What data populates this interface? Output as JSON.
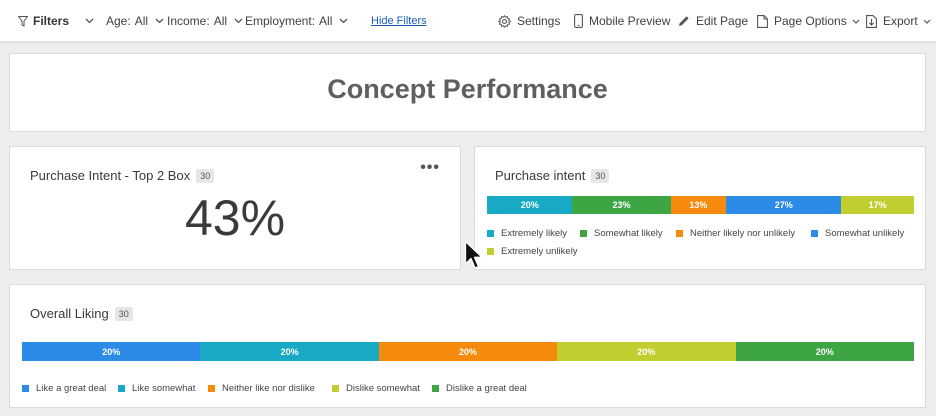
{
  "toolbar": {
    "filters_label": "Filters",
    "filters": [
      {
        "label": "Age:",
        "value": "All"
      },
      {
        "label": "Income:",
        "value": "All"
      },
      {
        "label": "Employment:",
        "value": "All"
      }
    ],
    "hide_filters": "Hide Filters",
    "settings": "Settings",
    "mobile_preview": "Mobile Preview",
    "edit_page": "Edit Page",
    "page_options": "Page Options",
    "export": "Export"
  },
  "page": {
    "title": "Concept Performance"
  },
  "purchase_intent_top2": {
    "title": "Purchase Intent - Top 2 Box",
    "count": "30",
    "value": "43%",
    "more_icon": "ellipsis-icon"
  },
  "purchase_intent": {
    "title": "Purchase intent",
    "count": "30",
    "segments": [
      {
        "label": "20%",
        "value": 20,
        "name": "Extremely likely",
        "color": "#18a9c4"
      },
      {
        "label": "23%",
        "value": 23,
        "name": "Somewhat likely",
        "color": "#3ea545"
      },
      {
        "label": "13%",
        "value": 13,
        "name": "Neither likely nor unlikely",
        "color": "#f58a0d"
      },
      {
        "label": "27%",
        "value": 27,
        "name": "Somewhat unlikely",
        "color": "#2b8be6"
      },
      {
        "label": "17%",
        "value": 17,
        "name": "Extremely unlikely",
        "color": "#c2ce2f"
      }
    ]
  },
  "overall_liking": {
    "title": "Overall Liking",
    "count": "30",
    "segments": [
      {
        "label": "20%",
        "value": 20,
        "name": "Like a great deal",
        "color": "#2b8be6"
      },
      {
        "label": "20%",
        "value": 20,
        "name": "Like somewhat",
        "color": "#18a9c4"
      },
      {
        "label": "20%",
        "value": 20,
        "name": "Neither like nor dislike",
        "color": "#f58a0d"
      },
      {
        "label": "20%",
        "value": 20,
        "name": "Dislike somewhat",
        "color": "#c2ce2f"
      },
      {
        "label": "20%",
        "value": 20,
        "name": "Dislike a great deal",
        "color": "#3ea545"
      }
    ]
  }
}
